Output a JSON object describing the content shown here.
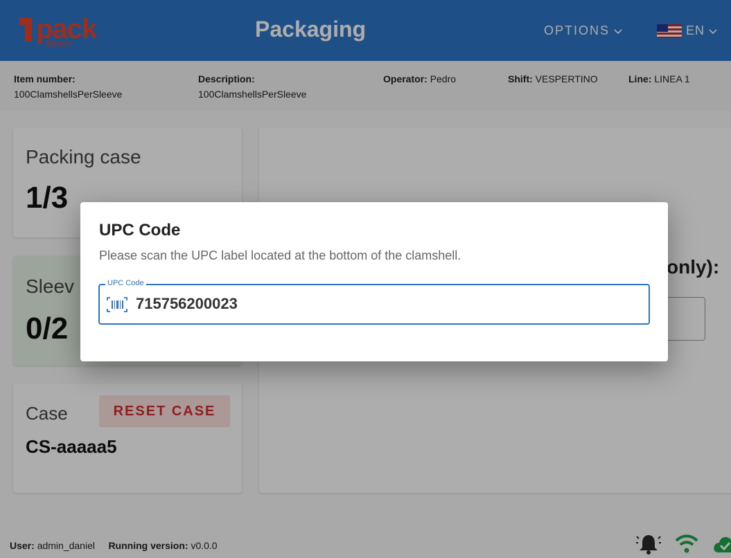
{
  "header": {
    "logo_word": "pack",
    "logo_sub": "&trace",
    "title": "Packaging",
    "options_label": "OPTIONS",
    "language": "EN"
  },
  "info": {
    "item_number_label": "Item number:",
    "item_number": "100ClamshellsPerSleeve",
    "description_label": "Description:",
    "description": "100ClamshellsPerSleeve",
    "operator_label": "Operator:",
    "operator": "Pedro",
    "shift_label": "Shift:",
    "shift": "VESPERTINO",
    "line_label": "Line:",
    "line": "LINEA 1"
  },
  "cards": {
    "packing_case_title": "Packing case",
    "packing_case_value": "1/3",
    "sleeve_title": "Sleev",
    "sleeve_value": "0/2",
    "case_title": "Case",
    "reset_label": "RESET CASE",
    "case_value": "CS-aaaaa5"
  },
  "right_panel": {
    "heading_fragment": "only):"
  },
  "footer": {
    "user_label": "User:",
    "user": "admin_daniel",
    "version_label": "Running version:",
    "version": "v0.0.0"
  },
  "dialog": {
    "title": "UPC Code",
    "message": "Please scan the UPC label located at the bottom of the clamshell.",
    "field_label": "UPC Code",
    "field_value": "715756200023"
  },
  "colors": {
    "primary": "#2d75c6",
    "brand": "#e8452c",
    "sleeve_card": "#e6f4e6",
    "danger": "#d32f2f"
  }
}
